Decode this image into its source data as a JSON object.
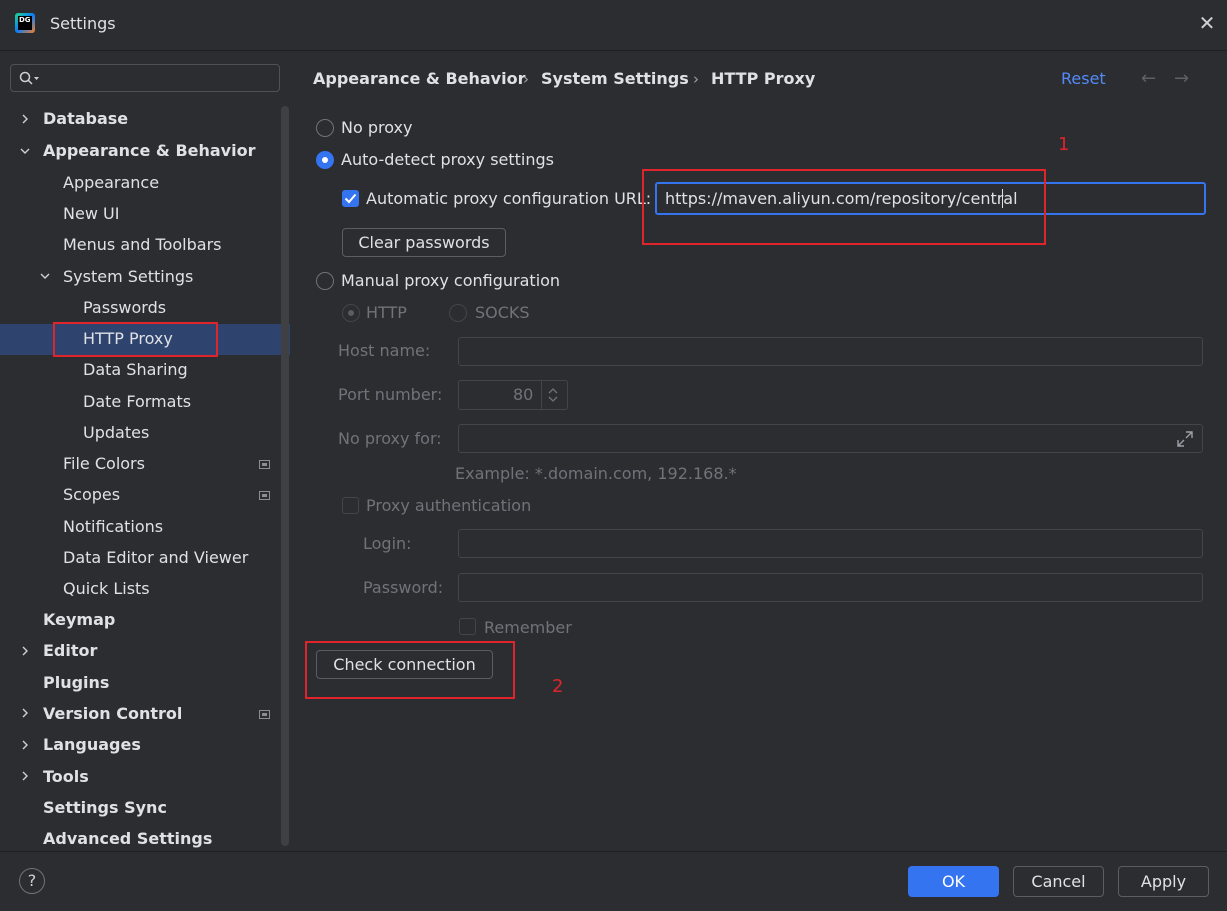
{
  "window": {
    "title": "Settings",
    "app_icon_text": "DG"
  },
  "search": {
    "placeholder": ""
  },
  "tree": {
    "database": "Database",
    "appearance_behavior": "Appearance & Behavior",
    "appearance": "Appearance",
    "new_ui": "New UI",
    "menus_toolbars": "Menus and Toolbars",
    "system_settings": "System Settings",
    "passwords": "Passwords",
    "http_proxy": "HTTP Proxy",
    "data_sharing": "Data Sharing",
    "date_formats": "Date Formats",
    "updates": "Updates",
    "file_colors": "File Colors",
    "scopes": "Scopes",
    "notifications": "Notifications",
    "data_editor_viewer": "Data Editor and Viewer",
    "quick_lists": "Quick Lists",
    "keymap": "Keymap",
    "editor": "Editor",
    "plugins": "Plugins",
    "version_control": "Version Control",
    "languages": "Languages",
    "tools": "Tools",
    "settings_sync": "Settings Sync",
    "advanced_settings": "Advanced Settings"
  },
  "breadcrumb": {
    "part1": "Appearance & Behavior",
    "sep": "›",
    "part2": "System Settings",
    "part3": "HTTP Proxy"
  },
  "header": {
    "reset": "Reset",
    "back": "←",
    "forward": "→"
  },
  "proxy": {
    "no_proxy": "No proxy",
    "auto_detect": "Auto-detect proxy settings",
    "auto_url_label": "Automatic proxy configuration URL:",
    "auto_url_value": "https://maven.aliyun.com/repository/central",
    "clear_passwords": "Clear passwords",
    "manual": "Manual proxy configuration",
    "http": "HTTP",
    "socks": "SOCKS",
    "host_label": "Host name:",
    "host_value": "",
    "port_label": "Port number:",
    "port_value": "80",
    "no_proxy_label": "No proxy for:",
    "no_proxy_value": "",
    "example": "Example: *.domain.com, 192.168.*",
    "proxy_auth": "Proxy authentication",
    "login_label": "Login:",
    "password_label": "Password:",
    "remember": "Remember",
    "check_connection": "Check connection"
  },
  "annotations": {
    "one": "1",
    "two": "2"
  },
  "footer": {
    "help": "?",
    "ok": "OK",
    "cancel": "Cancel",
    "apply": "Apply"
  },
  "colors": {
    "accent": "#3574f0",
    "link": "#548af7",
    "annotation": "#e0242b",
    "selection": "#2e436e",
    "background": "#2b2d30"
  }
}
